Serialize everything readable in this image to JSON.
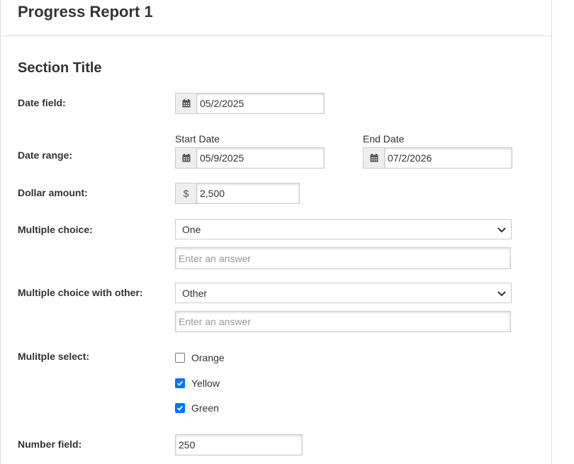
{
  "header": {
    "title": "Progress Report 1"
  },
  "section": {
    "title": "Section Title"
  },
  "fields": {
    "date_field": {
      "label": "Date field:",
      "value": "05/2/2025"
    },
    "date_range": {
      "label": "Date range:",
      "start_label": "Start Date",
      "start_value": "05/9/2025",
      "end_label": "End Date",
      "end_value": "07/2/2026"
    },
    "dollar_amount": {
      "label": "Dollar amount:",
      "currency_symbol": "$",
      "value": "2,500"
    },
    "multiple_choice": {
      "label": "Multiple choice:",
      "selected": "One",
      "answer_placeholder": "Enter an answer"
    },
    "multiple_choice_other": {
      "label": "Multiple choice with other:",
      "selected": "Other",
      "answer_placeholder": "Enter an answer"
    },
    "multiple_select": {
      "label": "Mulitple select:",
      "options": [
        {
          "label": "Orange",
          "checked": false
        },
        {
          "label": "Yellow",
          "checked": true
        },
        {
          "label": "Green",
          "checked": true
        }
      ]
    },
    "number_field": {
      "label": "Number field:",
      "value": "250"
    }
  },
  "icons": {
    "calendar": "calendar-icon",
    "dropdown": "chevron-down-icon",
    "check": "checkmark-icon"
  },
  "colors": {
    "checkbox_checked": "#0075ff",
    "border": "#cccccc",
    "addon_bg": "#eeeeee"
  }
}
